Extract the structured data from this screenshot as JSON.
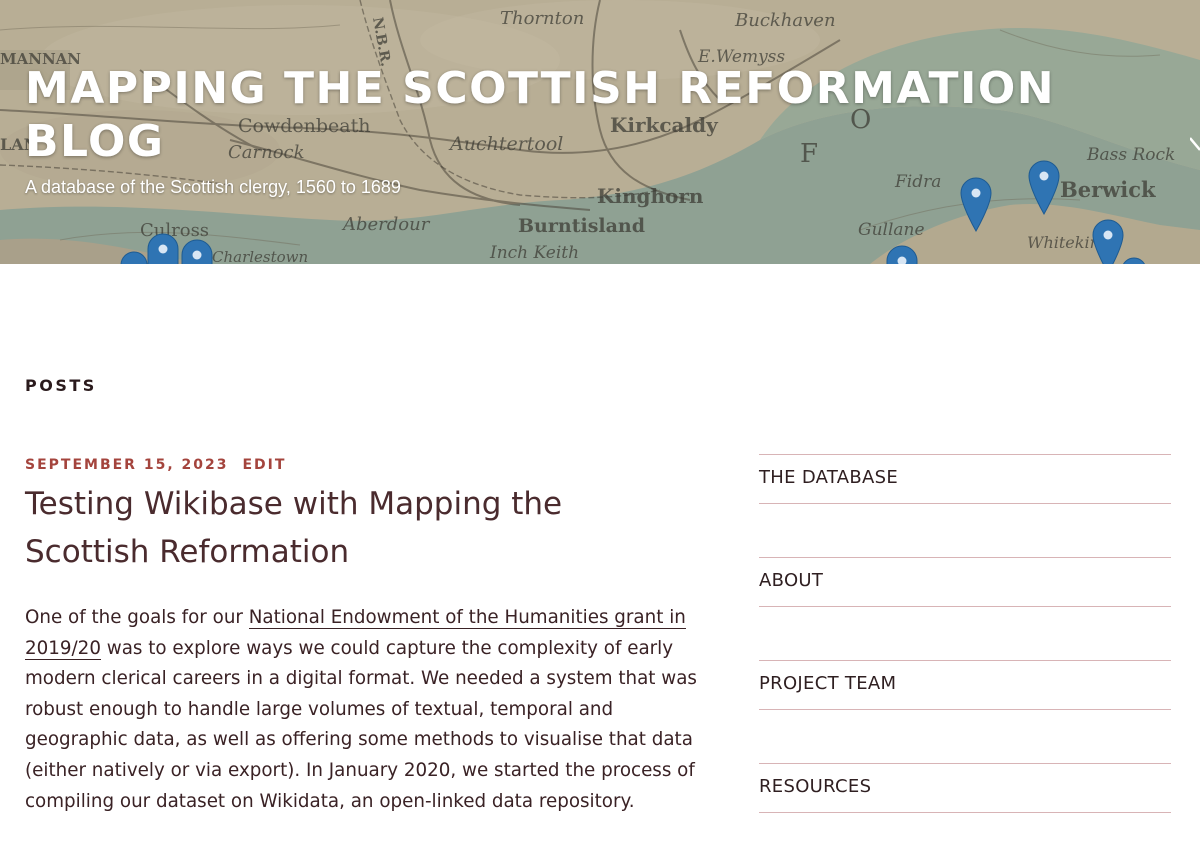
{
  "header": {
    "title": "MAPPING THE SCOTTISH REFORMATION BLOG",
    "tagline": "A database of the Scottish clergy, 1560 to 1689",
    "map_labels": [
      "Thornton",
      "Buckhaven",
      "E.Wemyss",
      "MANNAN",
      "Cowdenbeath",
      "Kirkcaldy",
      "Carnock",
      "Auchtertool",
      "Bass Rock",
      "Fidra",
      "Kinghorn",
      "Berwick",
      "Aberdour",
      "Burntisland",
      "Culross",
      "Gullane",
      "Inch Keith",
      "Charlestown",
      "N.B.R.",
      "Whitekirk",
      "F O",
      "LAN"
    ]
  },
  "main": {
    "section_heading": "POSTS",
    "post": {
      "date": "SEPTEMBER 15, 2023",
      "edit_label": "EDIT",
      "title": "Testing Wikibase with Mapping the Scottish Reformation",
      "excerpt_before_link": "One of the goals for our ",
      "excerpt_link": "National Endowment of the Humanities grant in 2019/20",
      "excerpt_after_link": " was to explore ways we could capture the complexity of early modern clerical careers in a digital format. We needed a system that was robust enough to handle large volumes of textual, temporal and geographic data, as well as offering some methods to visualise that data (either natively or via export). In January 2020, we started the process of compiling our dataset on Wikidata, an open-linked data repository."
    }
  },
  "sidebar": {
    "items": [
      {
        "label": "THE DATABASE"
      },
      {
        "label": "ABOUT"
      },
      {
        "label": "PROJECT TEAM"
      },
      {
        "label": "RESOURCES"
      }
    ]
  },
  "colors": {
    "accent": "#a4443d",
    "text": "#3a2225",
    "divider": "#d8b4b6",
    "pin": "#2f74b3",
    "map_land": "#b7ad93",
    "map_sea": "#8fa193"
  },
  "icons": {
    "map_pin": "map-pin-icon",
    "menu": "chevron-down-icon"
  }
}
